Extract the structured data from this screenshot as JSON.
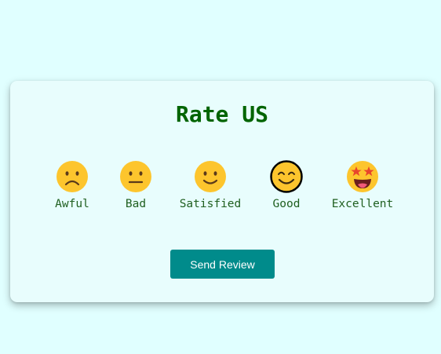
{
  "title": "Rate US",
  "options": [
    {
      "label": "Awful",
      "icon": "frowning-face-icon"
    },
    {
      "label": "Bad",
      "icon": "neutral-face-icon"
    },
    {
      "label": "Satisfied",
      "icon": "slightly-smiling-face-icon"
    },
    {
      "label": "Good",
      "icon": "smiling-face-icon",
      "selected": true
    },
    {
      "label": "Excellent",
      "icon": "star-struck-face-icon"
    }
  ],
  "submit_label": "Send Review",
  "colors": {
    "page_background": "#e0ffff",
    "card_background": "#e8fdfd",
    "title": "#006400",
    "labels": "#1f5f1f",
    "button": "#008b8b",
    "emoji_yellow": "#fdc52d"
  }
}
